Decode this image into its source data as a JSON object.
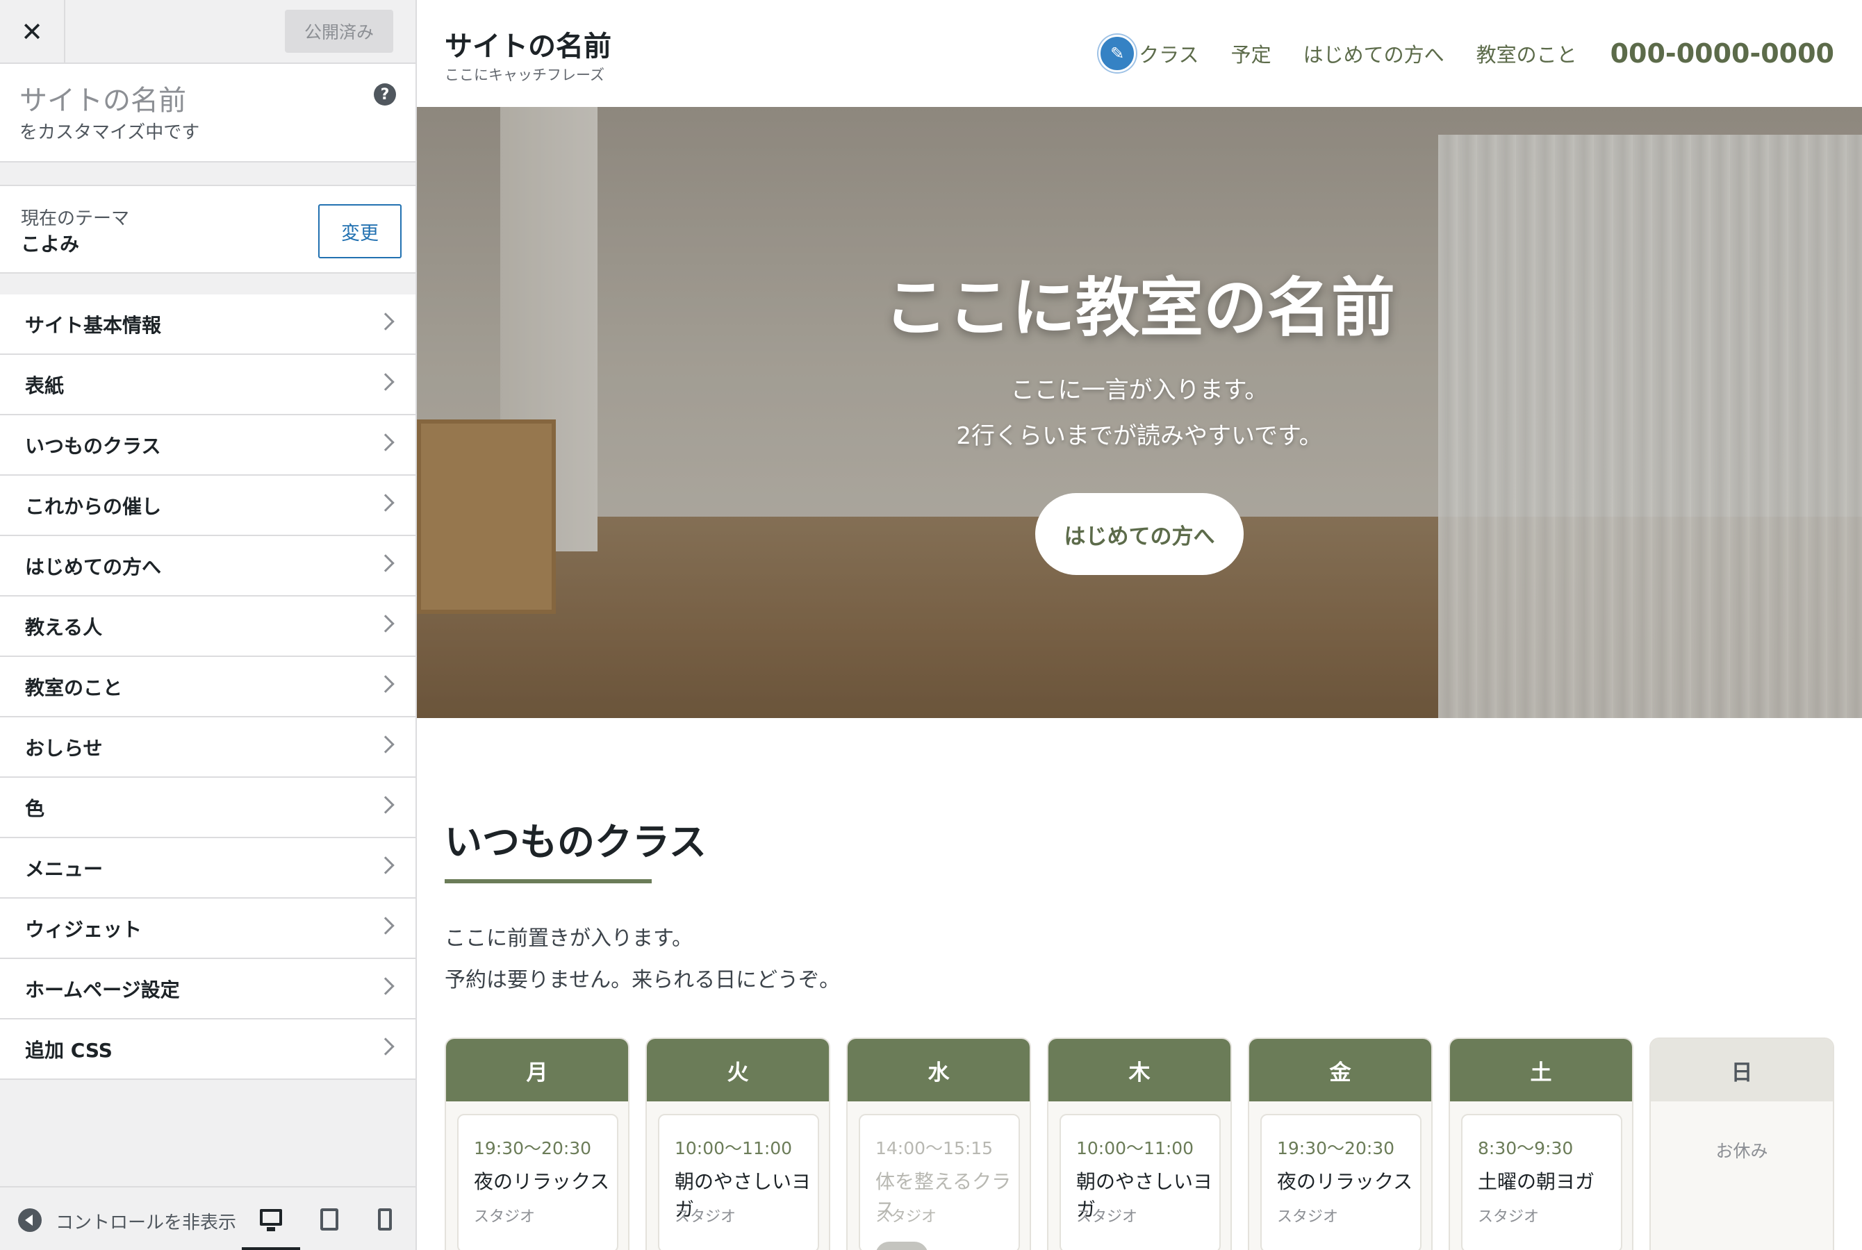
{
  "customizer": {
    "close_glyph": "✕",
    "publish_label": "公開済み",
    "site_name": "サイトの名前",
    "customizing_label": "をカスタマイズ中です",
    "help_glyph": "?",
    "theme_label": "現在のテーマ",
    "theme_name": "こよみ",
    "change_label": "変更",
    "menu": [
      {
        "label": "サイト基本情報"
      },
      {
        "label": "表紙"
      },
      {
        "label": "いつものクラス"
      },
      {
        "label": "これからの催し"
      },
      {
        "label": "はじめての方へ"
      },
      {
        "label": "教える人"
      },
      {
        "label": "教室のこと"
      },
      {
        "label": "おしらせ"
      },
      {
        "label": "色"
      },
      {
        "label": "メニュー"
      },
      {
        "label": "ウィジェット"
      },
      {
        "label": "ホームページ設定"
      },
      {
        "label": "追加 CSS"
      }
    ],
    "collapse_label": "コントロールを非表示"
  },
  "site": {
    "title": "サイトの名前",
    "tagline": "ここにキャッチフレーズ",
    "nav": [
      "クラス",
      "予定",
      "はじめての方へ",
      "教室のこと"
    ],
    "phone": "000-0000-0000",
    "edit_glyph": "✎"
  },
  "hero": {
    "title": "ここに教室の名前",
    "line1": "ここに一言が入ります。",
    "line2": "2行くらいまでが読みやすいです。",
    "button": "はじめての方へ"
  },
  "classes": {
    "title": "いつものクラス",
    "intro1": "ここに前置きが入ります。",
    "intro2": "予約は要りません。来られる日にどうぞ。",
    "days": [
      {
        "day": "月",
        "time": "19:30〜20:30",
        "name": "夜のリラックス",
        "place": "スタジオ"
      },
      {
        "day": "火",
        "time": "10:00〜11:00",
        "name": "朝のやさしいヨガ",
        "place": "スタジオ"
      },
      {
        "day": "水",
        "time": "14:00〜15:15",
        "name": "体を整えるクラス",
        "place": "スタジオ"
      },
      {
        "day": "木",
        "time": "10:00〜11:00",
        "name": "朝のやさしいヨガ",
        "place": "スタジオ"
      },
      {
        "day": "金",
        "time": "19:30〜20:30",
        "name": "夜のリラックス",
        "place": "スタジオ"
      },
      {
        "day": "土",
        "time": "8:30〜9:30",
        "name": "土曜の朝ヨガ",
        "place": "スタジオ"
      },
      {
        "day": "日",
        "off": "お休み"
      }
    ]
  },
  "colors": {
    "accent": "#6b7c58",
    "admin_blue": "#2271b1"
  }
}
